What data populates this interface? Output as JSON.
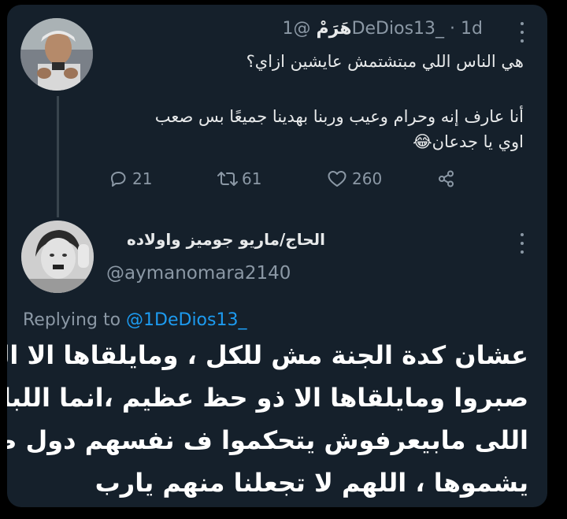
{
  "tweet1": {
    "display_name": "هَرَمْ",
    "handle": "@1DeDios13_",
    "separator": "·",
    "time": "1d",
    "lines": [
      "هي الناس اللي مبتشتمش عايشين ازاي؟",
      "أنا عارف إنه وحرام وعيب وربنا بهدينا جميعًا بس صعب",
      "اوي يا جدعان😂"
    ],
    "actions": {
      "replies": "21",
      "retweets": "61",
      "likes": "260"
    }
  },
  "tweet2": {
    "display_name": "الحاج/ماريو جوميز واولاده",
    "handle": "@aymanomara2140",
    "replying_prefix": "Replying to",
    "replying_to": "@1DeDios13_",
    "lines": [
      "عشان كدة الجنة مش للكل ، ومايلقاها الا اللذين",
      "صبروا ومايلقاها الا ذو حظ عظيم ،انما اللباوى",
      "اللى مابيعرفوش يتحكموا ف نفسهم دول صعب",
      "يشموها ، اللهم لا تجعلنا منهم يارب"
    ]
  },
  "colors": {
    "background": "#15202b",
    "accent": "#1d9bf0",
    "muted": "#8b98a5",
    "text": "#e7e9ea"
  },
  "icons": [
    "more-icon",
    "reply-icon",
    "retweet-icon",
    "like-icon",
    "share-icon"
  ]
}
